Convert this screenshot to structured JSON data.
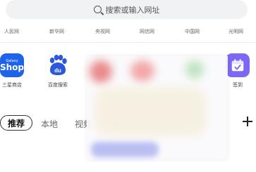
{
  "search": {
    "placeholder": "搜索或输入网址"
  },
  "sites": [
    {
      "label": "人民网"
    },
    {
      "label": "新华网"
    },
    {
      "label": "央视网"
    },
    {
      "label": "网信网"
    },
    {
      "label": "中国网"
    },
    {
      "label": "光明网"
    }
  ],
  "apps": [
    {
      "label": "三星商店",
      "icon": "galaxy-shop-icon",
      "icon_text_small": "Galaxy",
      "icon_text_big": "Shop"
    },
    {
      "label": "百度搜索",
      "icon": "baidu-icon"
    },
    {
      "label": "签到",
      "icon": "calendar-check-icon"
    }
  ],
  "tabs": {
    "active": "推荐",
    "items": [
      "本地",
      "视频"
    ]
  },
  "colors": {
    "shop_blue": "#1f63e8",
    "baidu_blue": "#2b57d9",
    "checkin_purple": "#7d68f5"
  }
}
